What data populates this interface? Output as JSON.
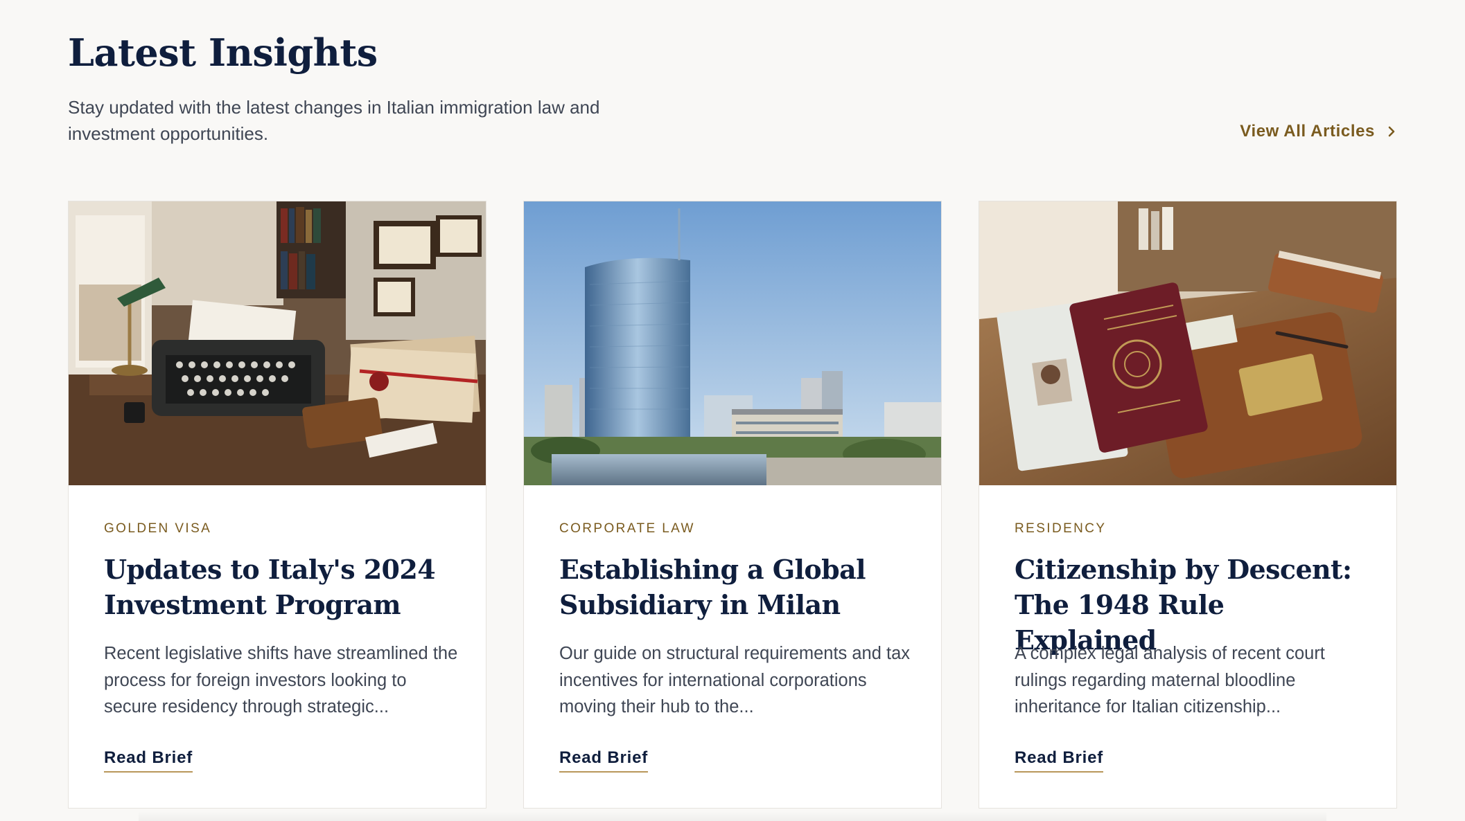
{
  "section": {
    "heading": "Latest Insights",
    "subtitle": "Stay updated with the latest changes in Italian immigration law and investment opportunities.",
    "view_all_label": "View All Articles",
    "view_all_icon": "chevron-right-icon"
  },
  "colors": {
    "navy": "#0f1e3d",
    "gold": "#7a5b1f",
    "underline": "#b8975a",
    "background": "#f9f8f6"
  },
  "cards": [
    {
      "category": "GOLDEN VISA",
      "title": "Updates to Italy's 2024 Investment Program",
      "excerpt": "Recent legislative shifts have streamlined the process for foreign investors looking to secure residency through strategic...",
      "cta": "Read Brief"
    },
    {
      "category": "CORPORATE LAW",
      "title": "Establishing a Global Subsidiary in Milan",
      "excerpt": "Our guide on structural requirements and tax incentives for international corporations moving their hub to the...",
      "cta": "Read Brief"
    },
    {
      "category": "RESIDENCY",
      "title": "Citizenship by Descent: The 1948 Rule Explained",
      "excerpt": "A complex legal analysis of recent court rulings regarding maternal bloodline inheritance for Italian citizenship...",
      "cta": "Read Brief"
    }
  ]
}
